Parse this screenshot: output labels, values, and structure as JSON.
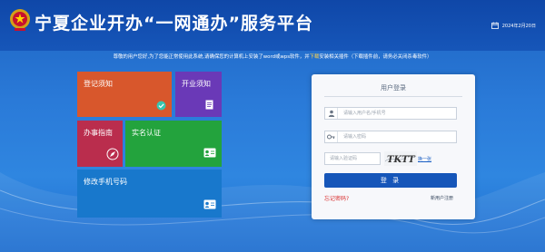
{
  "header": {
    "title": "宁夏企业开办“一网通办”服务平台",
    "date": "2024年2月20日",
    "icons": {
      "emblem": "national-emblem-icon",
      "calendar": "calendar-icon"
    }
  },
  "notice": {
    "part1": "尊敬的用户您好,为了您能正常使用此系统,请确保您的计算机上安装了word或wps软件，并",
    "link": "下载",
    "part2": "安装相关插件（下载插件前，请务必关闭杀毒软件）"
  },
  "tiles": {
    "registration_notice": "登记须知",
    "opening_notice": "开业须知",
    "guide": "办事指南",
    "real_name_auth": "实名认证",
    "change_phone": "修改手机号码"
  },
  "login": {
    "title": "用户登录",
    "username_placeholder": "请输入用户名/手机号",
    "password_placeholder": "请输入密码",
    "captcha_placeholder": "请输入验证码",
    "captcha_text": "TKTT",
    "refresh_captcha": "换一张",
    "submit": "登 录",
    "forgot_password": "忘记密码?",
    "register": "新用户注册"
  },
  "colors": {
    "header": "#1656b9",
    "tile_registration": "#d8572c",
    "tile_opening": "#6a39b7",
    "tile_guide": "#ba2d4d",
    "tile_auth": "#23a33d",
    "tile_phone": "#1878cc",
    "forgot_link": "#d92e2e"
  }
}
